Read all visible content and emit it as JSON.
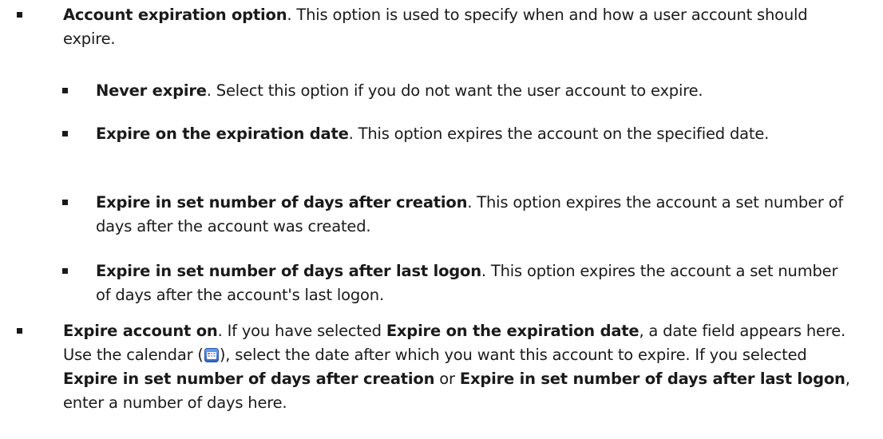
{
  "items": {
    "account_expiration": {
      "term": "Account expiration option",
      "desc": ". This option is used to specify when and how a user account should expire."
    },
    "never_expire": {
      "term": "Never expire",
      "desc": ". Select this option if you do not want the user account to expire."
    },
    "expire_on_date": {
      "term": "Expire on the expiration date",
      "desc": ". This option expires the account on the specified date."
    },
    "expire_after_creation": {
      "term": "Expire in set number of days after creation",
      "desc": ". This option expires the account a set number of days after the account was created."
    },
    "expire_after_logon": {
      "term": "Expire in set number of days after last logon",
      "desc": ". This option expires the account a set number of days after the account's last logon."
    },
    "expire_account_on": {
      "term": "Expire account on",
      "part1": ". If you have selected ",
      "ref1": "Expire on the expiration date",
      "part2": ", a date field appears here. Use the calendar (",
      "part3": "), select the date after which you want this account to expire. If you selected ",
      "ref2": "Expire in set number of days after creation",
      "part4": " or ",
      "ref3": "Expire in set number of days after last logon",
      "part5": ", enter a number of days here."
    }
  },
  "icons": {
    "calendar": "calendar-icon"
  },
  "colors": {
    "text": "#1a1a1a",
    "calendar_blue": "#3b78d8"
  }
}
